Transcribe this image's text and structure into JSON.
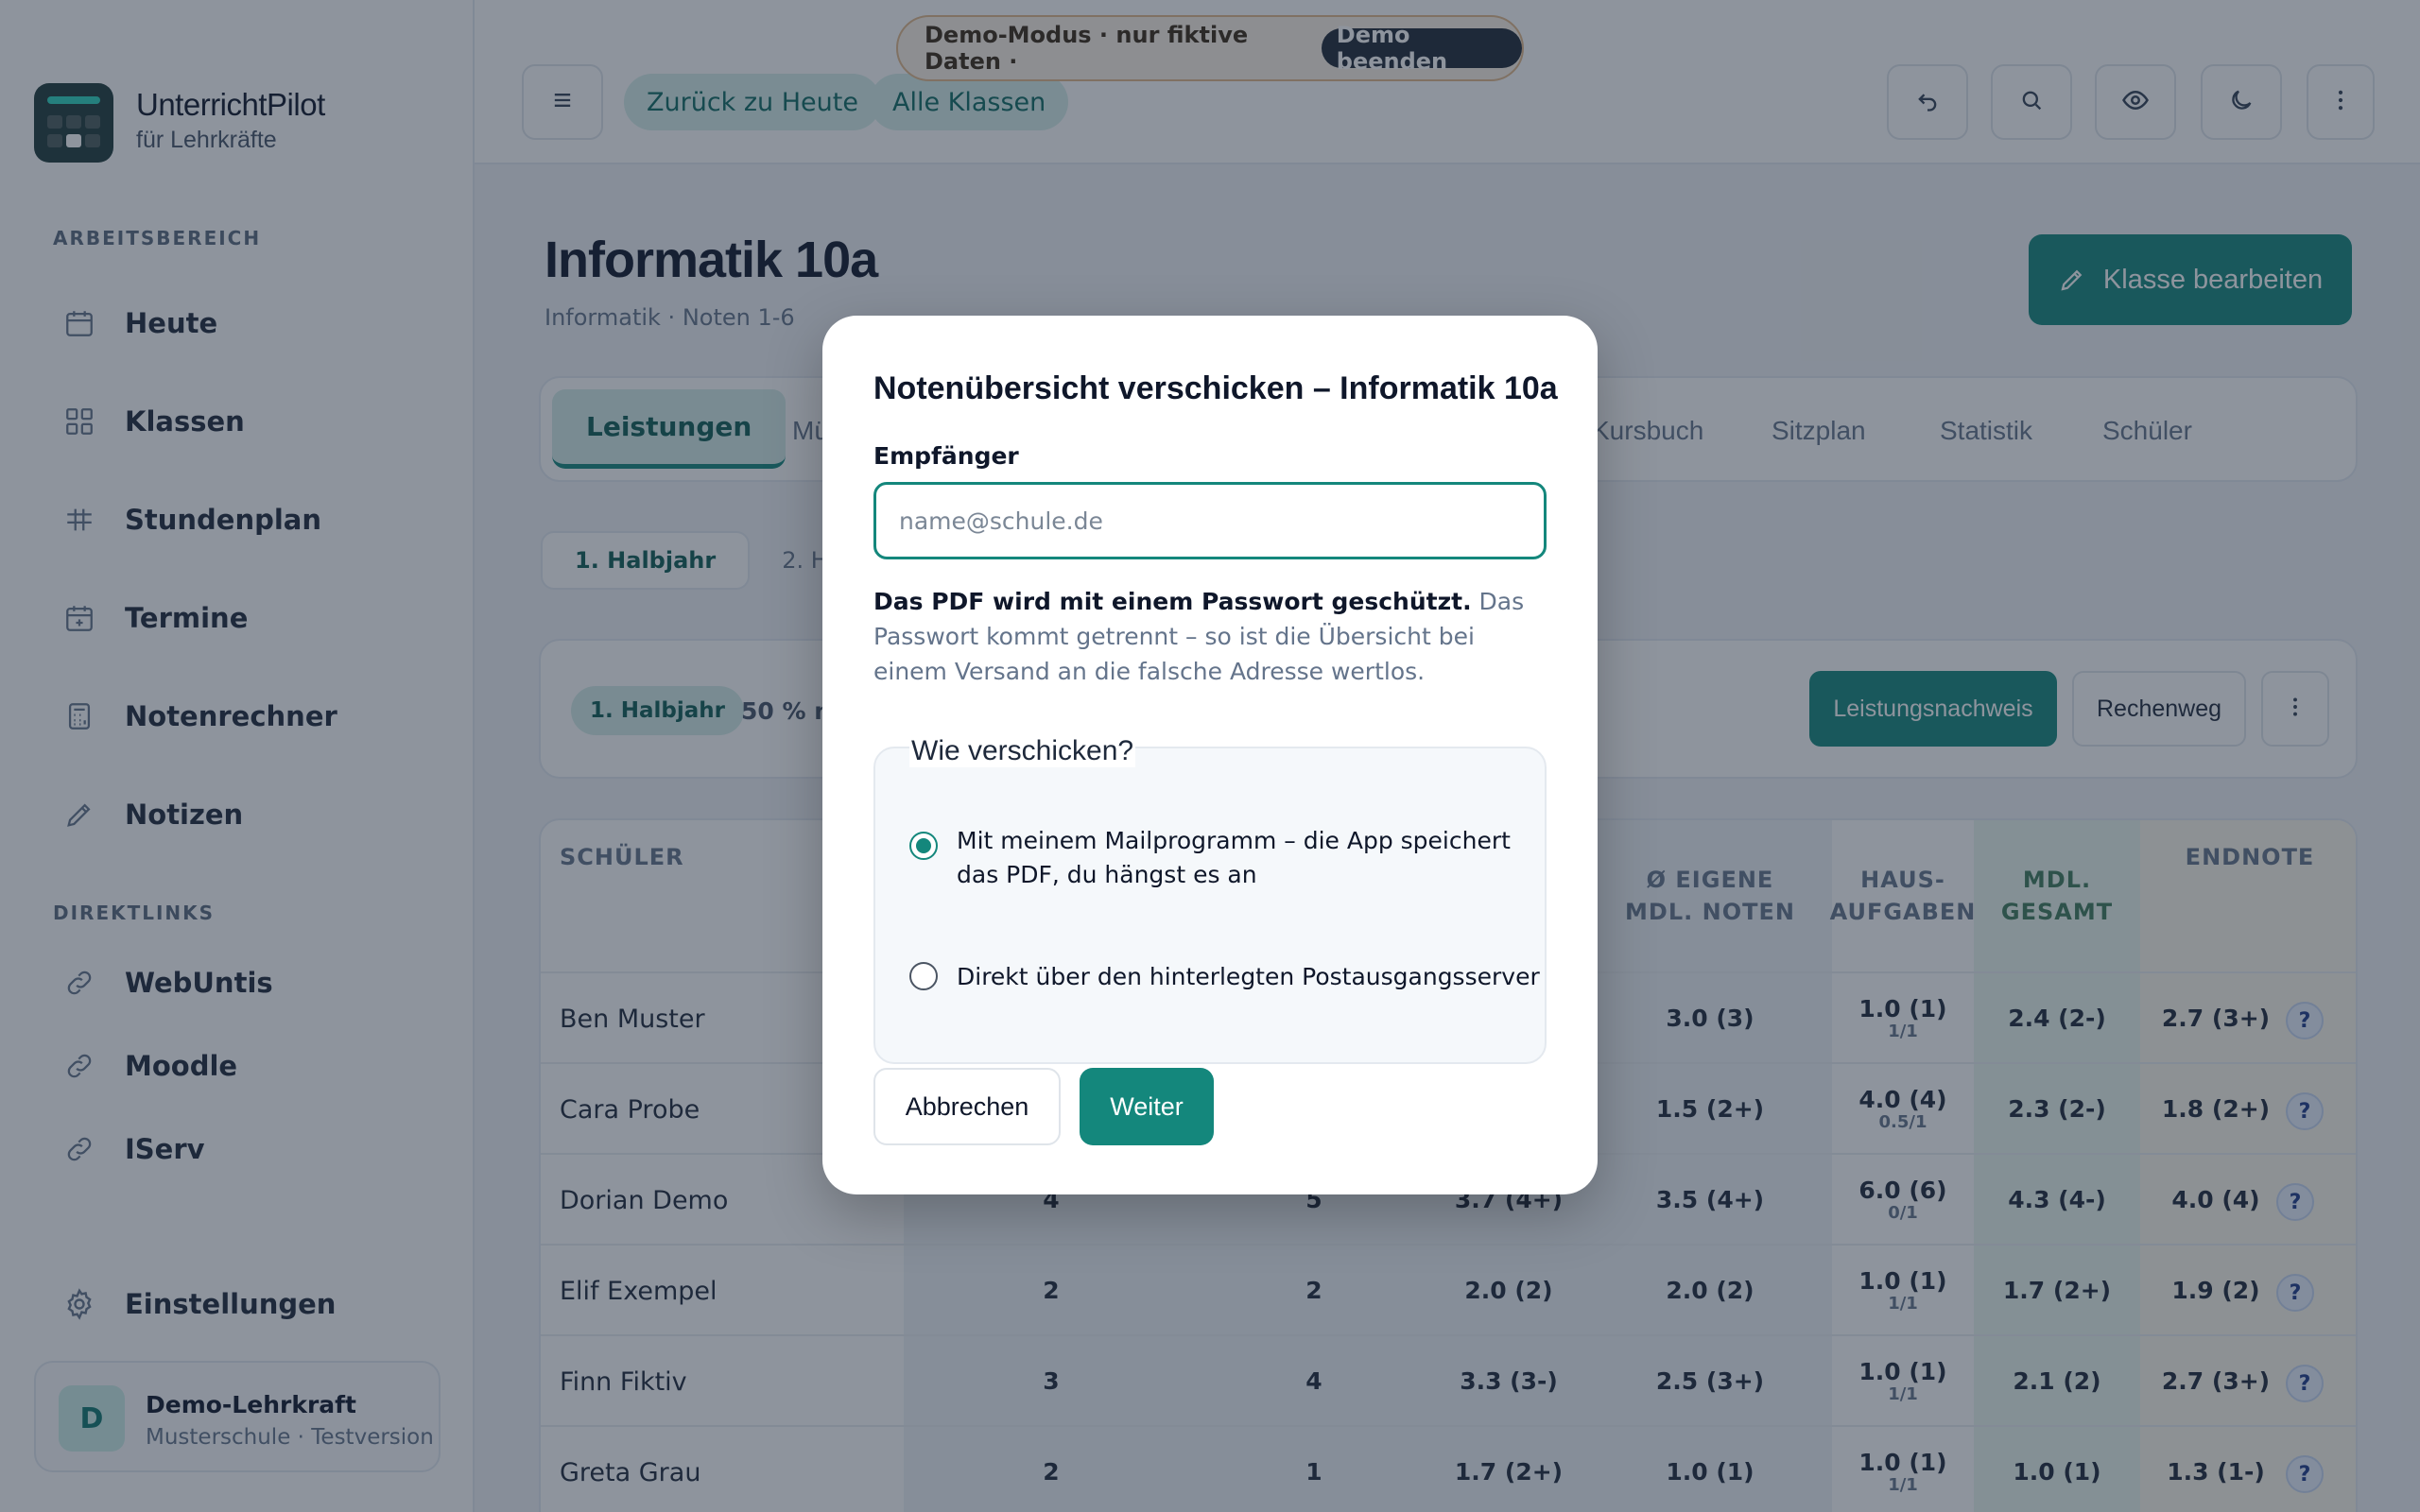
{
  "app": {
    "title": "UnterrichtPilot",
    "subtitle": "für Lehrkräfte"
  },
  "sidebar": {
    "section_work": "ARBEITSBEREICH",
    "items": [
      {
        "label": "Heute",
        "icon": "calendar-icon"
      },
      {
        "label": "Klassen",
        "icon": "grid-icon"
      },
      {
        "label": "Stundenplan",
        "icon": "timetable-icon"
      },
      {
        "label": "Termine",
        "icon": "calendar-plus-icon"
      },
      {
        "label": "Notenrechner",
        "icon": "calculator-icon"
      },
      {
        "label": "Notizen",
        "icon": "pencil-icon"
      }
    ],
    "section_links": "DIREKTLINKS",
    "links": [
      {
        "label": "WebUntis",
        "icon": "link-icon"
      },
      {
        "label": "Moodle",
        "icon": "link-icon"
      },
      {
        "label": "IServ",
        "icon": "link-icon"
      }
    ],
    "settings": "Einstellungen",
    "user": {
      "initial": "D",
      "name": "Demo-Lehrkraft",
      "sub": "Musterschule · Testversion"
    }
  },
  "topbar": {
    "back_today": "Zurück zu Heute",
    "all_classes": "Alle Klassen",
    "demo_text": "Demo-Modus · nur fiktive Daten ·",
    "demo_end": "Demo beenden"
  },
  "page": {
    "title": "Informatik 10a",
    "subtitle": "Informatik · Noten 1-6",
    "edit_button": "Klasse bearbeiten",
    "tabs": [
      "Leistungen",
      "Mü",
      "Kursbuch",
      "Sitzplan",
      "Statistik",
      "Schüler"
    ],
    "half_tabs": [
      "1. Halbjahr",
      "2. Hal"
    ],
    "toolbar": {
      "pill": "1. Halbjahr",
      "text": "50 % m",
      "proof_button": "Leistungsnachweis",
      "calc_button": "Rechenweg"
    }
  },
  "table": {
    "headers": {
      "student": "SCHÜLER",
      "own_oral": "Ø EIGENE\nMDL. NOTEN",
      "homework": "HAUS-\nAUFGABEN",
      "oral_total": "MDL.\nGESAMT",
      "final": "ENDNOTE"
    },
    "rows": [
      {
        "name": "Ben Muster",
        "c1": "",
        "c2": "",
        "c3": "",
        "own": "3.0 (3)",
        "hw": "1.0 (1)",
        "hw_sub": "1/1",
        "oral": "2.4 (2-)",
        "final": "2.7 (3+)"
      },
      {
        "name": "Cara Probe",
        "c1": "",
        "c2": "",
        "c3": "",
        "own": "1.5 (2+)",
        "hw": "4.0 (4)",
        "hw_sub": "0.5/1",
        "oral": "2.3 (2-)",
        "final": "1.8 (2+)"
      },
      {
        "name": "Dorian Demo",
        "c1": "4",
        "c2": "5",
        "c3": "3.7 (4+)",
        "own": "3.5 (4+)",
        "hw": "6.0 (6)",
        "hw_sub": "0/1",
        "oral": "4.3 (4-)",
        "final": "4.0 (4)"
      },
      {
        "name": "Elif Exempel",
        "c1": "2",
        "c2": "2",
        "c3": "2.0 (2)",
        "own": "2.0 (2)",
        "hw": "1.0 (1)",
        "hw_sub": "1/1",
        "oral": "1.7 (2+)",
        "final": "1.9 (2)"
      },
      {
        "name": "Finn Fiktiv",
        "c1": "3",
        "c2": "4",
        "c3": "3.3 (3-)",
        "own": "2.5 (3+)",
        "hw": "1.0 (1)",
        "hw_sub": "1/1",
        "oral": "2.1 (2)",
        "final": "2.7 (3+)"
      },
      {
        "name": "Greta Grau",
        "c1": "2",
        "c2": "1",
        "c3": "1.7 (2+)",
        "own": "1.0 (1)",
        "hw": "1.0 (1)",
        "hw_sub": "1/1",
        "oral": "1.0 (1)",
        "final": "1.3 (1-)"
      }
    ],
    "help": "?"
  },
  "modal": {
    "title": "Notenübersicht verschicken – Informatik 10a",
    "recipient_label": "Empfänger",
    "recipient_placeholder": "name@schule.de",
    "recipient_value": "",
    "pw_bold": "Das PDF wird mit einem Passwort geschützt.",
    "pw_rest": " Das Passwort kommt getrennt – so ist die Übersicht bei einem Versand an die falsche Adresse wertlos.",
    "how_legend": "Wie verschicken?",
    "option_mail": "Mit meinem Mailprogramm – die App speichert das PDF, du hängst es an",
    "option_server": "Direkt über den hinterlegten Postausgangsserver",
    "cancel": "Abbrechen",
    "next": "Weiter"
  },
  "colors": {
    "accent": "#14877c",
    "accent_light": "#d5ede8",
    "demo_border": "#e2b98a"
  }
}
